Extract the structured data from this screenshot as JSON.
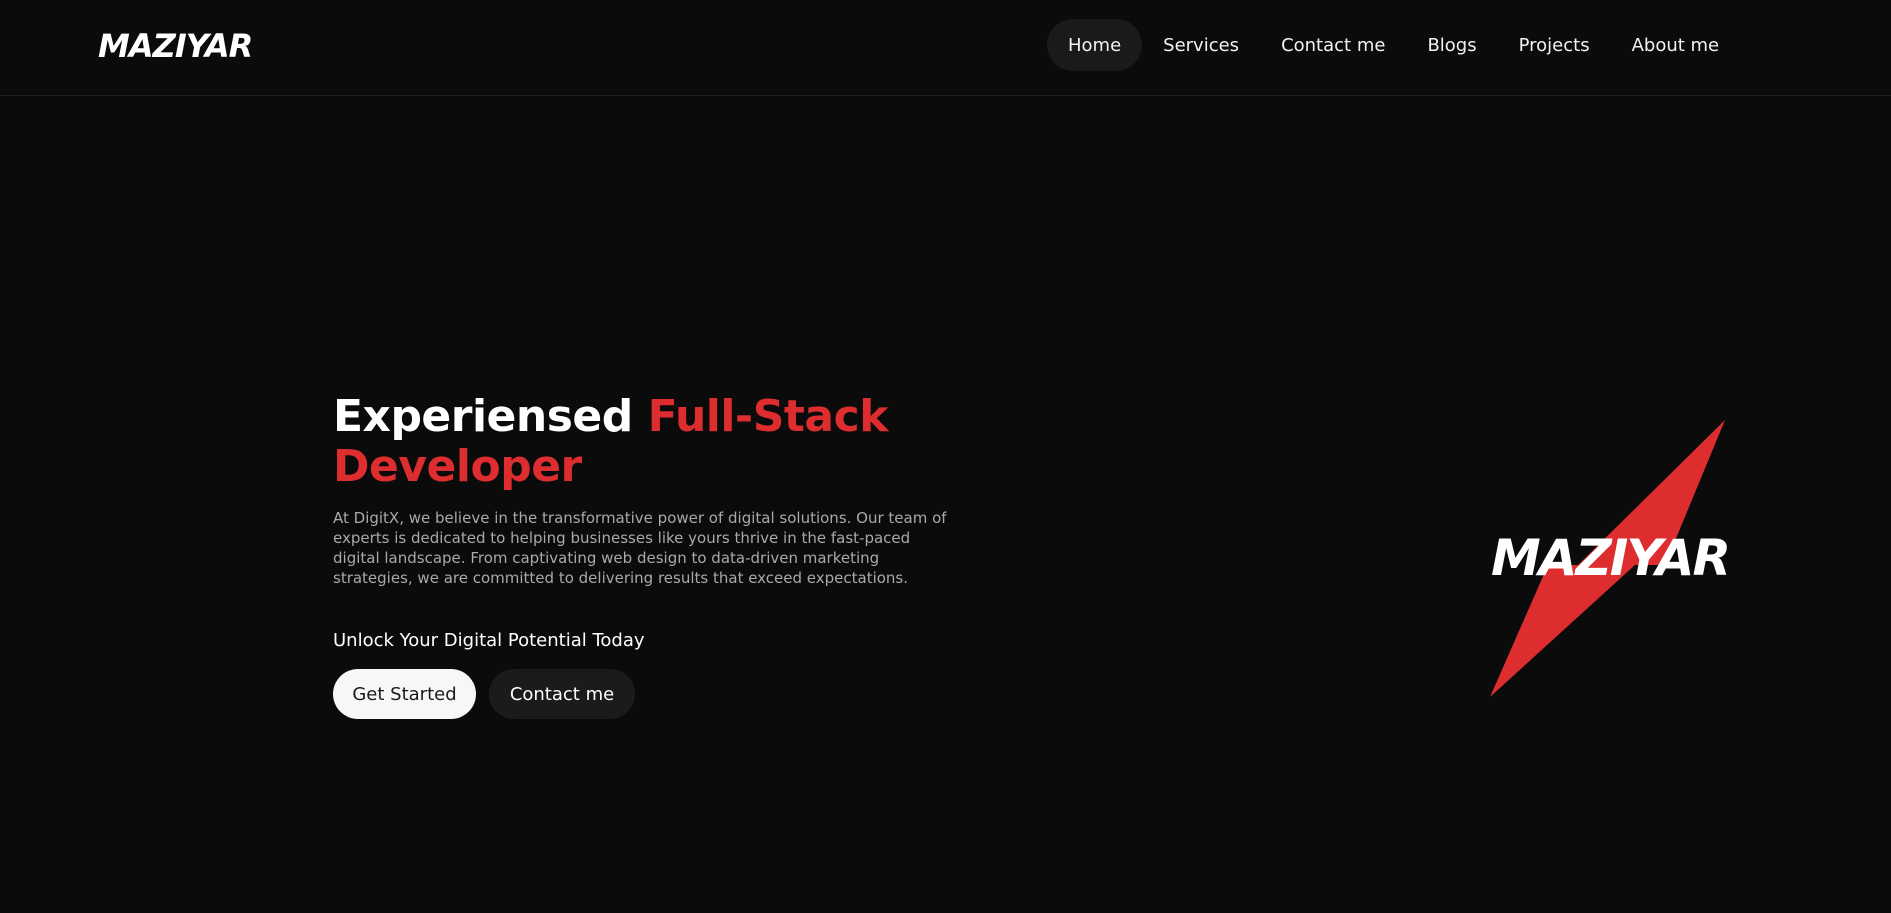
{
  "brand": {
    "logo_text": "MAZIYAR"
  },
  "nav": {
    "items": [
      {
        "label": "Home",
        "active": true
      },
      {
        "label": "Services",
        "active": false
      },
      {
        "label": "Contact me",
        "active": false
      },
      {
        "label": "Blogs",
        "active": false
      },
      {
        "label": "Projects",
        "active": false
      },
      {
        "label": "About me",
        "active": false
      }
    ]
  },
  "hero": {
    "headline_white": "Experiensed ",
    "headline_red": "Full-Stack Developer",
    "description": "At DigitX, we believe in the transformative power of digital solutions. Our team of experts is dedicated to helping businesses like yours thrive in the fast-paced digital landscape. From captivating web design to data-driven marketing strategies, we are committed to delivering results that exceed expectations.",
    "subheading": "Unlock Your Digital Potential Today",
    "primary_button": "Get Started",
    "secondary_button": "Contact me"
  },
  "graphic": {
    "logo_text": "MAZIYAR",
    "icon": "lightning-bolt-icon"
  },
  "colors": {
    "background": "#0b0b0b",
    "accent_red": "#dd2d2f",
    "nav_active_bg": "#1a1a1a",
    "text_muted": "#a9a9a9"
  }
}
